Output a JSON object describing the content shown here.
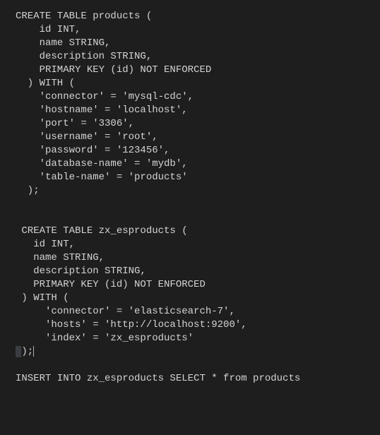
{
  "code_lines": [
    "CREATE TABLE products (",
    "    id INT,",
    "    name STRING,",
    "    description STRING,",
    "    PRIMARY KEY (id) NOT ENFORCED",
    "  ) WITH (",
    "    'connector' = 'mysql-cdc',",
    "    'hostname' = 'localhost',",
    "    'port' = '3306',",
    "    'username' = 'root',",
    "    'password' = '123456',",
    "    'database-name' = 'mydb',",
    "    'table-name' = 'products'",
    "  );",
    "",
    "",
    " CREATE TABLE zx_esproducts (",
    "   id INT,",
    "   name STRING,",
    "   description STRING,",
    "   PRIMARY KEY (id) NOT ENFORCED",
    " ) WITH (",
    "     'connector' = 'elasticsearch-7',",
    "     'hosts' = 'http://localhost:9200',",
    "     'index' = 'zx_esproducts'",
    " );",
    "",
    "INSERT INTO zx_esproducts SELECT * from products"
  ],
  "cursor_line_index": 25,
  "cursor_after_char": ";"
}
